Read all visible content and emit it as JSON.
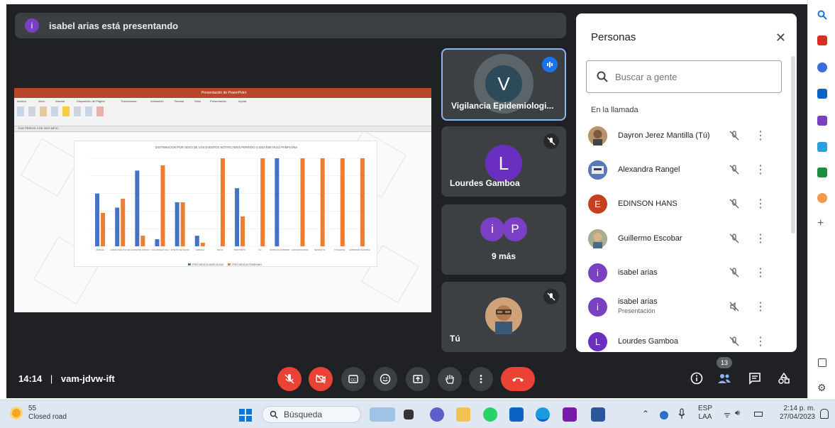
{
  "banner": {
    "avatar_letter": "i",
    "text": "isabel arias está presentando"
  },
  "presentation": {
    "window_title": "Presentación de PowerPoint",
    "ribbon_tabs": [
      "Archivo",
      "Inicio",
      "Insertar",
      "Disposición de Página",
      "Transiciones",
      "Animación",
      "Revisar",
      "Vista",
      "Presentación",
      "Ayuda"
    ],
    "doc_tab": "EVE PERIOD 4 DE 2023 MPIO.",
    "chart_title": "DISTRIBUCION POR SEXO DE LOS EVENTOS NOTIFICADOS PERIODO 4 2023 ESE HUSJ PAMPLONA",
    "legend": [
      "FRECUENCIA MASCULINO",
      "FRECUENCIA FEMENINO"
    ]
  },
  "chart_data": {
    "type": "bar",
    "title": "DISTRIBUCION POR SEXO DE LOS EVENTOS NOTIFICADOS PERIODO 4 2023 ESE HUSJ PAMPLONA",
    "categories": [
      "DENGUE",
      "AGRESIONES POR ANIMALES POTENCIALMENTE TRANSMISORES DE RABIA",
      "ACCIDENTE OFIDICO",
      "VIGILANCIA EN SALUD PUBLICA DE LAS VIOLENCIAS DE GENERO",
      "INTENTO DE SUICIDIO",
      "VARICELA",
      "SIFILIS",
      "PAROTIDITIS",
      "VIH",
      "MORTALIDAD PERINATAL",
      "CANCER DE MAMA",
      "MENINGITIS",
      "TOS FERINA",
      "MORBILIDAD MATERNA EXTREMA"
    ],
    "series": [
      {
        "name": "FRECUENCIA MASCULINO",
        "color": "#4472c4",
        "values": [
          3,
          2.2,
          4.3,
          0.4,
          2.5,
          0.6,
          0,
          3.3,
          0,
          5,
          0,
          0,
          0,
          0
        ]
      },
      {
        "name": "FRECUENCIA FEMENINO",
        "color": "#ed7d31",
        "values": [
          1.9,
          2.7,
          0.6,
          4.6,
          2.5,
          0.2,
          5,
          1.7,
          5,
          0,
          5,
          5,
          5,
          5
        ]
      }
    ],
    "ylim": [
      0,
      5
    ]
  },
  "tiles": [
    {
      "initial": "V",
      "name": "Vigilancia Epidemiologi...",
      "color": "#2c4a5a",
      "state": "speaking"
    },
    {
      "initial": "L",
      "name": "Lourdes Gamboa",
      "color": "#6a2fc0",
      "state": "muted"
    },
    {
      "initial_a": "i",
      "initial_b": "P",
      "name": "9 más",
      "color_a": "#7b3fc4",
      "color_b": "#7b3fc4"
    },
    {
      "name": "Tú",
      "state": "muted"
    }
  ],
  "people_panel": {
    "title": "Personas",
    "search_placeholder": "Buscar a gente",
    "section": "En la llamada",
    "participants": [
      {
        "name": "Dayron Jerez Mantilla (Tú)",
        "avatar": "photo",
        "color": "#9a7b5a",
        "mic": "muted"
      },
      {
        "name": "Alexandra Rangel",
        "avatar": "photo",
        "color": "#3b5998",
        "mic": "muted"
      },
      {
        "name": "EDINSON HANS",
        "avatar": "E",
        "color": "#c5401f",
        "mic": "muted"
      },
      {
        "name": "Guillermo Escobar",
        "avatar": "photo",
        "color": "#8a8f6b",
        "mic": "muted"
      },
      {
        "name": "isabel arias",
        "avatar": "i",
        "color": "#7b3fc4",
        "mic": "muted"
      },
      {
        "name": "isabel arias",
        "sub": "Presentación",
        "avatar": "i",
        "color": "#7b3fc4",
        "mic": "audio-off"
      },
      {
        "name": "Lourdes Gamboa",
        "avatar": "L",
        "color": "#6a2fc0",
        "mic": "muted"
      }
    ]
  },
  "bottom": {
    "time": "14:14",
    "separator": "|",
    "meeting_code": "vam-jdvw-ift",
    "people_count": "13"
  },
  "taskbar": {
    "weather_temp": "55",
    "weather_desc": "Closed road",
    "search_label": "Búsqueda",
    "lang_top": "ESP",
    "lang_bottom": "LAA",
    "clock_time": "2:14 p. m.",
    "clock_date": "27/04/2023"
  }
}
